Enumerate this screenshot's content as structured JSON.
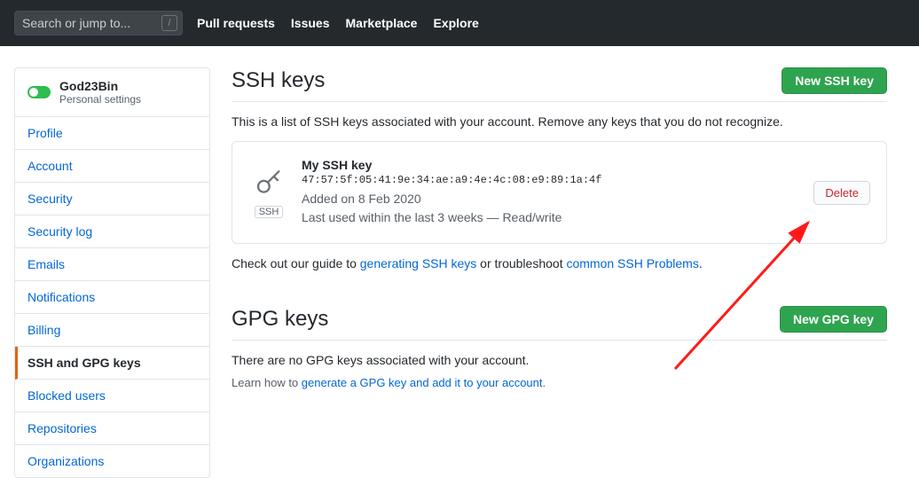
{
  "topbar": {
    "search_placeholder": "Search or jump to...",
    "slash": "/",
    "nav": [
      "Pull requests",
      "Issues",
      "Marketplace",
      "Explore"
    ]
  },
  "sidebar": {
    "username": "God23Bin",
    "subtitle": "Personal settings",
    "items": [
      {
        "label": "Profile",
        "active": false
      },
      {
        "label": "Account",
        "active": false
      },
      {
        "label": "Security",
        "active": false
      },
      {
        "label": "Security log",
        "active": false
      },
      {
        "label": "Emails",
        "active": false
      },
      {
        "label": "Notifications",
        "active": false
      },
      {
        "label": "Billing",
        "active": false
      },
      {
        "label": "SSH and GPG keys",
        "active": true
      },
      {
        "label": "Blocked users",
        "active": false
      },
      {
        "label": "Repositories",
        "active": false
      },
      {
        "label": "Organizations",
        "active": false
      }
    ]
  },
  "ssh": {
    "heading": "SSH keys",
    "new_button": "New SSH key",
    "description": "This is a list of SSH keys associated with your account. Remove any keys that you do not recognize.",
    "key": {
      "badge": "SSH",
      "name": "My SSH key",
      "fingerprint": "47:57:5f:05:41:9e:34:ae:a9:4e:4c:08:e9:89:1a:4f",
      "added": "Added on 8 Feb 2020",
      "last_used": "Last used within the last 3 weeks — Read/write",
      "delete_label": "Delete"
    },
    "guide_prefix": "Check out our guide to ",
    "guide_link1": "generating SSH keys",
    "guide_mid": " or troubleshoot ",
    "guide_link2": "common SSH Problems",
    "guide_suffix": "."
  },
  "gpg": {
    "heading": "GPG keys",
    "new_button": "New GPG key",
    "empty_text": "There are no GPG keys associated with your account.",
    "learn_prefix": "Learn how to ",
    "learn_link": "generate a GPG key and add it to your account",
    "learn_suffix": "."
  }
}
